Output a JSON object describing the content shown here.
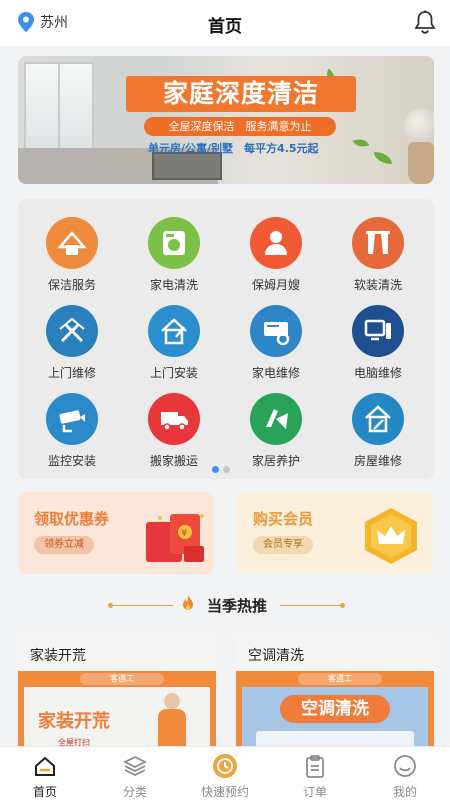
{
  "header": {
    "city": "苏州",
    "title": "首页"
  },
  "banner": {
    "title": "家庭深度清洁",
    "subtitle": "全屋深度保洁　服务满意为止",
    "price_line": "单元房/公寓/别墅　每平方4.5元起"
  },
  "services": [
    {
      "label": "保洁服务",
      "icon": "cleaning-icon",
      "color": "#f08a3c"
    },
    {
      "label": "家电清洗",
      "icon": "washer-icon",
      "color": "#7cc04a"
    },
    {
      "label": "保姆月嫂",
      "icon": "nanny-icon",
      "color": "#ef5a34"
    },
    {
      "label": "软装清洗",
      "icon": "curtain-icon",
      "color": "#e5693a"
    },
    {
      "label": "上门维修",
      "icon": "repair-tools-icon",
      "color": "#2a7fbd"
    },
    {
      "label": "上门安装",
      "icon": "install-icon",
      "color": "#2a8ecf"
    },
    {
      "label": "家电维修",
      "icon": "appliance-repair-icon",
      "color": "#2f86c6"
    },
    {
      "label": "电脑维修",
      "icon": "computer-icon",
      "color": "#1f4f8f"
    },
    {
      "label": "监控安装",
      "icon": "camera-icon",
      "color": "#2b88c9"
    },
    {
      "label": "搬家搬运",
      "icon": "truck-icon",
      "color": "#e8373b"
    },
    {
      "label": "家居养护",
      "icon": "furniture-care-icon",
      "color": "#2aa35a"
    },
    {
      "label": "房屋维修",
      "icon": "house-repair-icon",
      "color": "#2388c4"
    }
  ],
  "promos": {
    "coupon": {
      "title": "领取优惠券",
      "button": "领券立减",
      "color": "#f07c3a",
      "bg": "#fbe3d6"
    },
    "member": {
      "title": "购买会员",
      "button": "会员专享",
      "color": "#e8973a",
      "bg": "#fdf0dc"
    }
  },
  "section": {
    "title": "当季热推"
  },
  "features": [
    {
      "title": "家装开荒",
      "badge": "客遇工",
      "image_text": "家装开荒",
      "small": "全屋打扫"
    },
    {
      "title": "空调清洗",
      "badge": "客遇工",
      "image_text": "空调清洗"
    }
  ],
  "nav": [
    {
      "label": "首页",
      "icon": "home-icon",
      "active": true
    },
    {
      "label": "分类",
      "icon": "layers-icon",
      "active": false
    },
    {
      "label": "快速预约",
      "icon": "clock-icon",
      "active": false
    },
    {
      "label": "订单",
      "icon": "clipboard-icon",
      "active": false
    },
    {
      "label": "我的",
      "icon": "profile-icon",
      "active": false
    }
  ],
  "colors": {
    "accent": "#f08a3c",
    "active_dot": "#3d8ff0"
  }
}
